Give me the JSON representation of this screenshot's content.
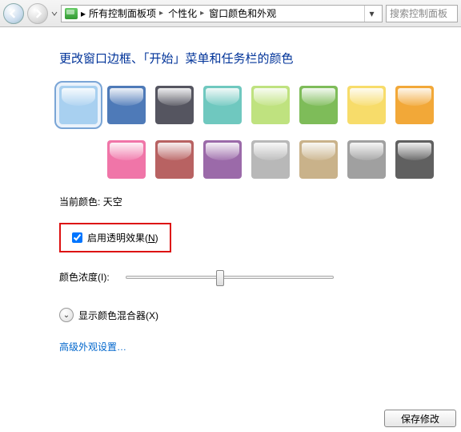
{
  "toolbar": {
    "breadcrumb": [
      "所有控制面板项",
      "个性化",
      "窗口颜色和外观"
    ],
    "search_placeholder": "搜索控制面板"
  },
  "page": {
    "title": "更改窗口边框、「开始」菜单和任务栏的颜色"
  },
  "colors": {
    "row1": [
      {
        "color": "#a8d0f0",
        "selected": true
      },
      {
        "color": "#4e7ab8"
      },
      {
        "color": "#555560"
      },
      {
        "color": "#6fc8bf"
      },
      {
        "color": "#bfe27f"
      },
      {
        "color": "#7ebc59"
      },
      {
        "color": "#f7dc6a"
      },
      {
        "color": "#f2a838"
      }
    ],
    "row2": [
      {
        "color": "#ffffff"
      },
      {
        "color": "#f075a8"
      },
      {
        "color": "#b86262"
      },
      {
        "color": "#9b6aa9"
      },
      {
        "color": "#b8b8b8"
      },
      {
        "color": "#c9b28a"
      },
      {
        "color": "#a0a0a0"
      },
      {
        "color": "#606060"
      }
    ]
  },
  "current_color": {
    "label": "当前颜色:",
    "value": "天空"
  },
  "transparency": {
    "label": "启用透明效果(N)",
    "hotkey": "N",
    "checked": true
  },
  "intensity": {
    "label": "颜色浓度(I):",
    "value": 45
  },
  "mixer": {
    "label": "显示颜色混合器(X)"
  },
  "advanced_link": "高级外观设置…",
  "footer": {
    "save": "保存修改"
  }
}
